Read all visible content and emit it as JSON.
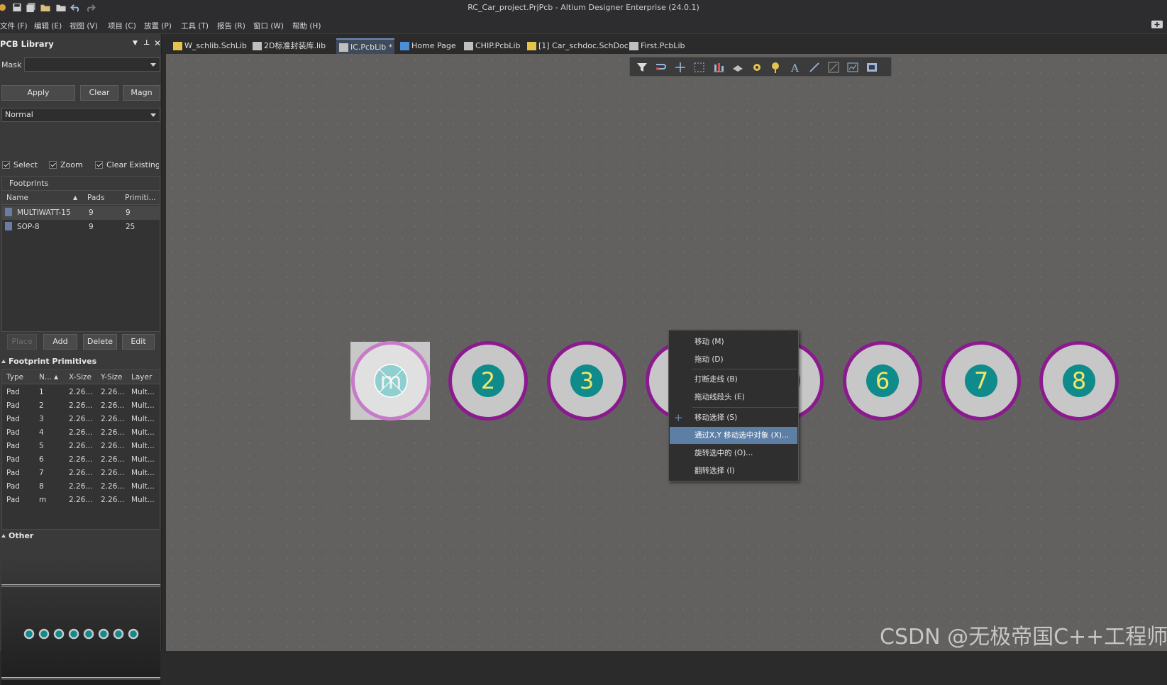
{
  "window": {
    "title": "RC_Car_project.PrjPcb - Altium Designer Enterprise (24.0.1)"
  },
  "menu": [
    "文件 (F)",
    "编辑 (E)",
    "视图 (V)",
    "项目 (C)",
    "放置 (P)",
    "工具 (T)",
    "报告 (R)",
    "窗口 (W)",
    "帮助 (H)"
  ],
  "panel": {
    "title": "PCB Library",
    "mask_label": "Mask",
    "mask_value": "",
    "apply": "Apply",
    "clear": "Clear",
    "magn": "Magn",
    "mode": "Normal",
    "select": "Select",
    "zoom": "Zoom",
    "clear_existing": "Clear Existing",
    "footprints_label": "Footprints",
    "fp_cols": [
      "Name",
      "Pads",
      "Primiti..."
    ],
    "fp_rows": [
      [
        "MULTIWATT-15",
        "9",
        "9"
      ],
      [
        "SOP-8",
        "9",
        "25"
      ]
    ],
    "place": "Place",
    "add": "Add",
    "delete": "Delete",
    "edit": "Edit",
    "prim_label": "Footprint Primitives",
    "prim_cols": [
      "Type",
      "N...",
      "X-Size",
      "Y-Size",
      "Layer"
    ],
    "prim_rows": [
      [
        "Pad",
        "1",
        "2.26...",
        "2.26...",
        "Mult..."
      ],
      [
        "Pad",
        "2",
        "2.26...",
        "2.26...",
        "Mult..."
      ],
      [
        "Pad",
        "3",
        "2.26...",
        "2.26...",
        "Mult..."
      ],
      [
        "Pad",
        "4",
        "2.26...",
        "2.26...",
        "Mult..."
      ],
      [
        "Pad",
        "5",
        "2.26...",
        "2.26...",
        "Mult..."
      ],
      [
        "Pad",
        "6",
        "2.26...",
        "2.26...",
        "Mult..."
      ],
      [
        "Pad",
        "7",
        "2.26...",
        "2.26...",
        "Mult..."
      ],
      [
        "Pad",
        "8",
        "2.26...",
        "2.26...",
        "Mult..."
      ],
      [
        "Pad",
        "m",
        "2.26...",
        "2.26...",
        "Mult..."
      ]
    ],
    "other_label": "Other"
  },
  "tabs": [
    "W_schlib.SchLib",
    "2D标准封装库.lib",
    "IC.PcbLib *",
    "Home Page",
    "CHIP.PcbLib",
    "[1] Car_schdoc.SchDoc",
    "First.PcbLib"
  ],
  "pads": [
    "m",
    "2",
    "3",
    "",
    "",
    "6",
    "7",
    "8"
  ],
  "context_menu": [
    "移动 (M)",
    "拖动 (D)",
    "打断走线 (B)",
    "拖动线段头 (E)",
    "移动选择 (S)",
    "通过X,Y 移动选中对象 (X)...",
    "旋转选中的 (O)...",
    "翻转选择 (I)"
  ],
  "watermark": "CSDN @无极帝国C++工程师",
  "colors": {
    "pad_ring": "#8a1a8e",
    "pad_core": "#0f8b8b",
    "pad_text": "#f5e66a",
    "canvas": "#636160",
    "highlight": "#5d7fa6"
  }
}
